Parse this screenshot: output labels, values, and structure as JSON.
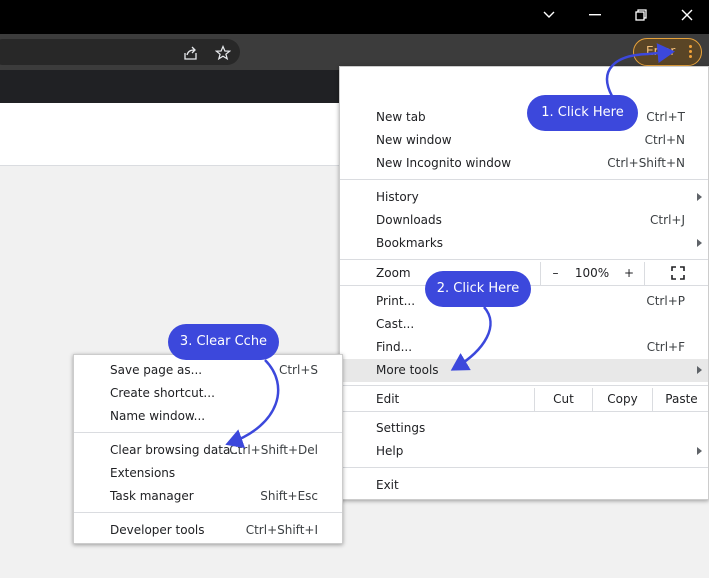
{
  "window": {
    "controls": [
      "chevron-down-icon",
      "minimize-icon",
      "restore-icon",
      "close-icon"
    ]
  },
  "toolbar": {
    "share_icon": "share-icon",
    "star_icon": "star-icon",
    "profile_chip_label": "Error",
    "menu_icon": "three-dots-vertical-icon",
    "accent_color": "#e8a33b"
  },
  "main_menu": {
    "new_tab": {
      "label": "New tab",
      "shortcut": "Ctrl+T"
    },
    "new_window": {
      "label": "New window",
      "shortcut": "Ctrl+N"
    },
    "new_incognito": {
      "label": "New Incognito window",
      "shortcut": "Ctrl+Shift+N"
    },
    "history": {
      "label": "History"
    },
    "downloads": {
      "label": "Downloads",
      "shortcut": "Ctrl+J"
    },
    "bookmarks": {
      "label": "Bookmarks"
    },
    "zoom": {
      "label": "Zoom",
      "minus": "–",
      "value": "100%",
      "plus": "+",
      "fullscreen_icon": "fullscreen-icon"
    },
    "print": {
      "label": "Print...",
      "shortcut": "Ctrl+P"
    },
    "cast": {
      "label": "Cast..."
    },
    "find": {
      "label": "Find...",
      "shortcut": "Ctrl+F"
    },
    "more_tools": {
      "label": "More tools"
    },
    "edit": {
      "label": "Edit",
      "cut": "Cut",
      "copy": "Copy",
      "paste": "Paste"
    },
    "settings": {
      "label": "Settings"
    },
    "help": {
      "label": "Help"
    },
    "exit": {
      "label": "Exit"
    }
  },
  "sub_menu": {
    "save_page": {
      "label": "Save page as...",
      "shortcut": "Ctrl+S"
    },
    "create_shortcut": {
      "label": "Create shortcut..."
    },
    "name_window": {
      "label": "Name window..."
    },
    "clear_data": {
      "label": "Clear browsing data...",
      "shortcut": "Ctrl+Shift+Del"
    },
    "extensions": {
      "label": "Extensions"
    },
    "task_manager": {
      "label": "Task manager",
      "shortcut": "Shift+Esc"
    },
    "developer_tools": {
      "label": "Developer tools",
      "shortcut": "Ctrl+Shift+I"
    }
  },
  "annotations": {
    "step1": "1. Click Here",
    "step2": "2. Click Here",
    "step3": "3. Clear Cche",
    "color": "#3c48dc"
  }
}
